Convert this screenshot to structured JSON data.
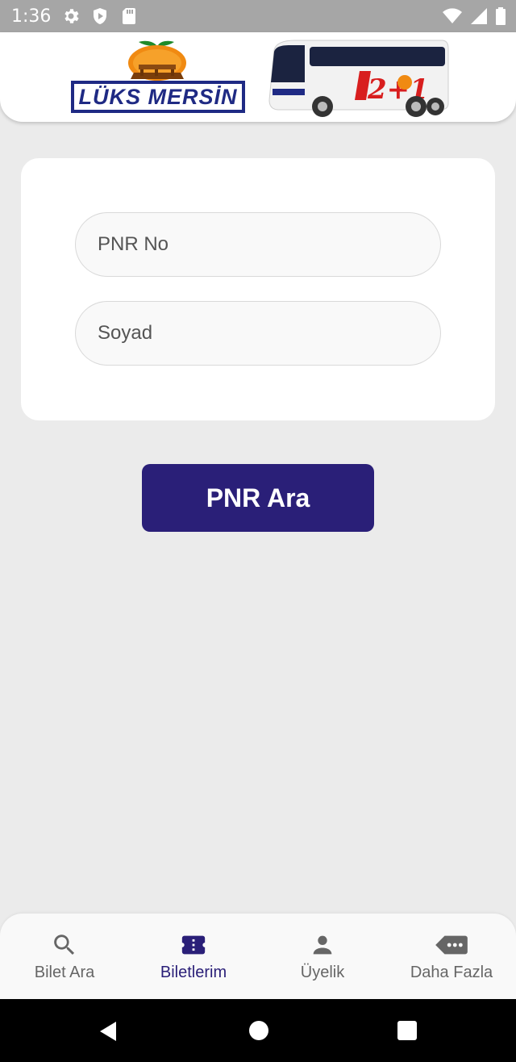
{
  "status_bar": {
    "time": "1:36",
    "icons_left": [
      "gear-icon",
      "shield-icon",
      "sd-card-icon"
    ],
    "icons_right": [
      "wifi-icon",
      "signal-icon",
      "battery-icon"
    ]
  },
  "header": {
    "brand_text": "LÜKS MERSİN",
    "bus_livery_text": "2+1"
  },
  "form": {
    "pnr_placeholder": "PNR No",
    "surname_placeholder": "Soyad",
    "pnr_value": "",
    "surname_value": ""
  },
  "actions": {
    "search_label": "PNR Ara"
  },
  "bottom_nav": {
    "items": [
      {
        "label": "Bilet Ara",
        "icon": "search-icon",
        "active": false
      },
      {
        "label": "Biletlerim",
        "icon": "ticket-icon",
        "active": true
      },
      {
        "label": "Üyelik",
        "icon": "person-icon",
        "active": false
      },
      {
        "label": "Daha Fazla",
        "icon": "more-tag-icon",
        "active": false
      }
    ]
  },
  "system_nav": [
    "back-icon",
    "home-icon",
    "recents-icon"
  ],
  "colors": {
    "primary": "#2a1f78",
    "background": "#ebebeb",
    "card": "#ffffff",
    "status_bar": "#a6a6a6",
    "brand_blue": "#1f2a84",
    "brand_orange": "#f08a12"
  }
}
